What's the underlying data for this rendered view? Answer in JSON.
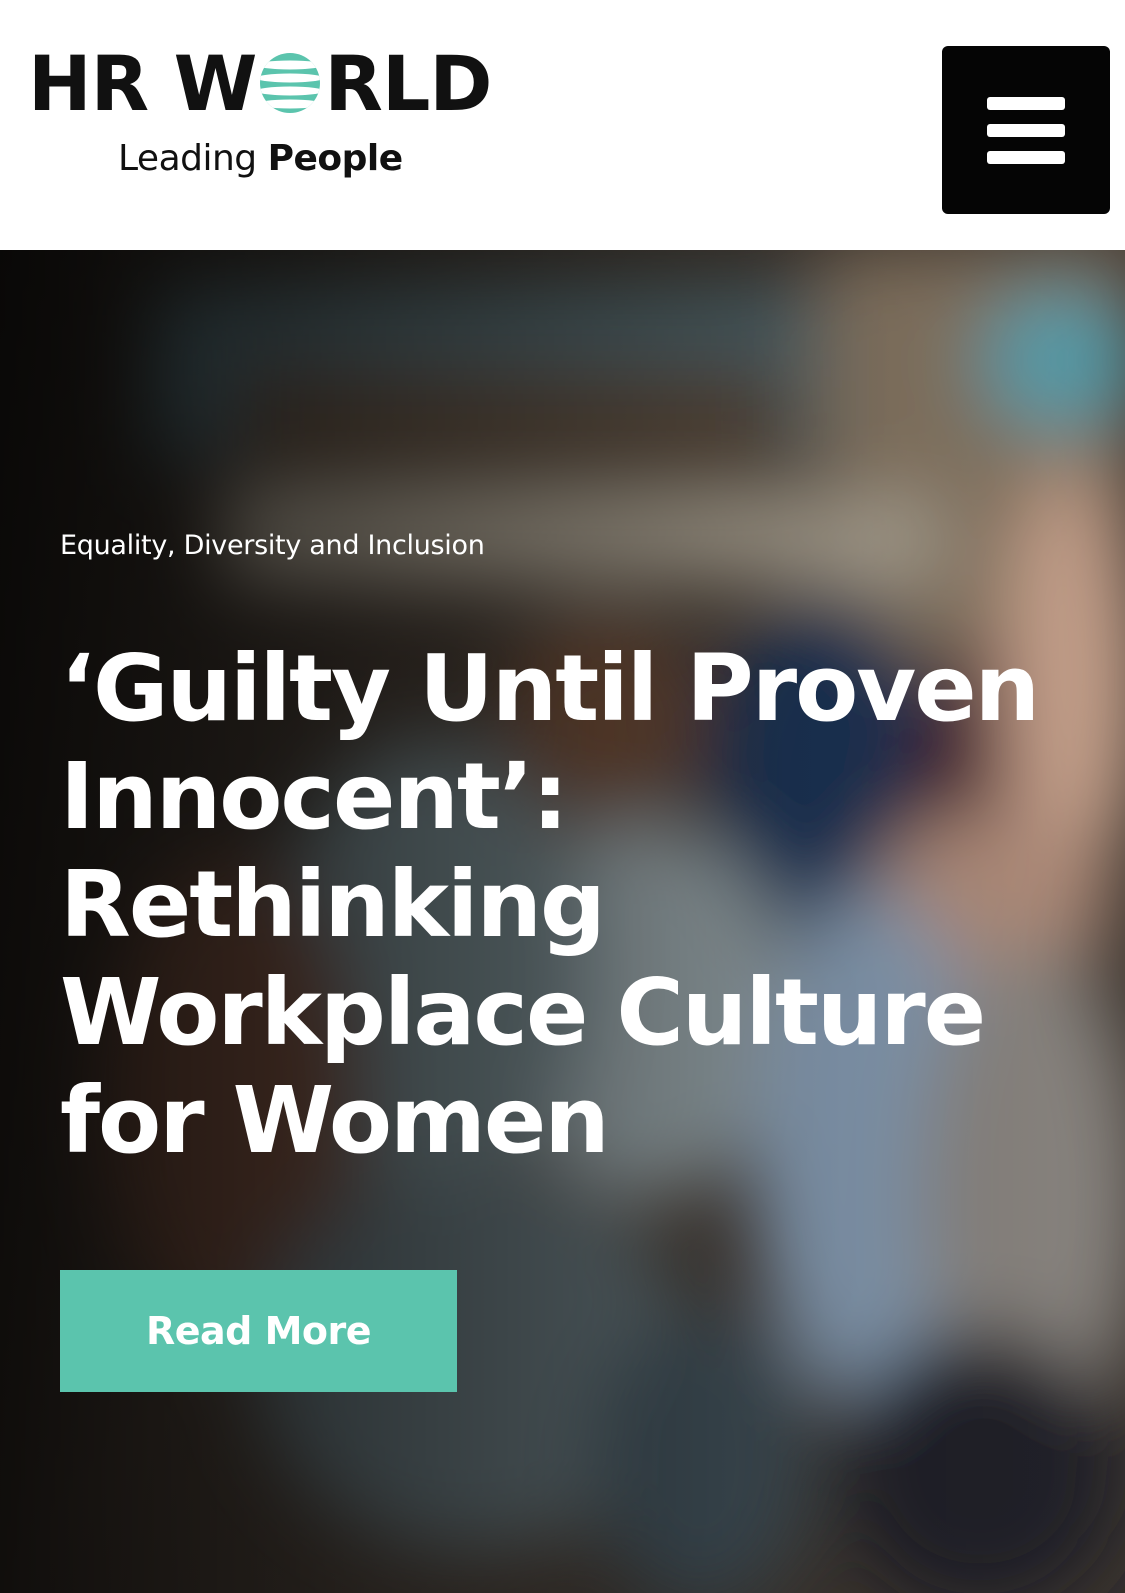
{
  "header": {
    "logo": {
      "part1": "HR W",
      "part2": "RLD",
      "tagline_light": "Leading ",
      "tagline_bold": "People"
    },
    "menu_icon": "hamburger-menu-icon"
  },
  "hero": {
    "category": "Equality, Diversity and Inclusion",
    "headline_lines": [
      "‘Guilty Until Proven",
      "Innocent’:",
      "Rethinking",
      "Workplace Culture",
      "for Women"
    ],
    "cta_label": "Read More"
  },
  "colors": {
    "accent": "#5bc4ad",
    "text_dark": "#111111",
    "menu_bg": "#050505"
  }
}
